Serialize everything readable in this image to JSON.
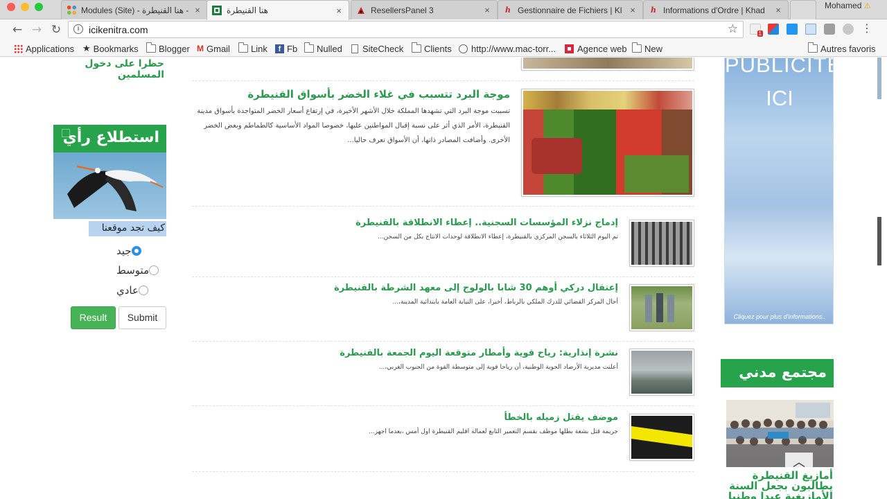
{
  "browser": {
    "tabs": [
      {
        "title": "Modules (Site) - هنا القنيطرة - ...",
        "icon": "joomla-icon",
        "active": false
      },
      {
        "title": "هنا القنيطرة",
        "icon": "site-favicon-icon",
        "active": true
      },
      {
        "title": "ResellersPanel 3",
        "icon": "resellerspanel-icon",
        "active": false
      },
      {
        "title": "Gestionnaire de Fichiers | Kl",
        "icon": "hosting-h-icon",
        "active": false
      },
      {
        "title": "Informations d'Ordre | Khad",
        "icon": "hosting-h-icon",
        "active": false
      }
    ],
    "profile_name": "Mohamed",
    "url": "icikenitra.com",
    "bookmarks": [
      {
        "label": "Applications",
        "icon": "apps-grid-icon"
      },
      {
        "label": "Bookmarks",
        "icon": "star-icon"
      },
      {
        "label": "Blogger",
        "icon": "folder-icon"
      },
      {
        "label": "Gmail",
        "icon": "gmail-icon"
      },
      {
        "label": "Link",
        "icon": "folder-icon"
      },
      {
        "label": "Fb",
        "icon": "facebook-icon"
      },
      {
        "label": "Nulled",
        "icon": "folder-icon"
      },
      {
        "label": "SiteCheck",
        "icon": "page-icon"
      },
      {
        "label": "Clients",
        "icon": "folder-icon"
      },
      {
        "label": "http://www.mac-torr...",
        "icon": "globe-icon"
      },
      {
        "label": "Agence web",
        "icon": "agence-icon"
      },
      {
        "label": "New",
        "icon": "folder-icon"
      }
    ],
    "other_bookmarks": "Autres favoris"
  },
  "left": {
    "cut_text_line1": "حظرا على دخول",
    "cut_text_line2": "المسلمين",
    "poll": {
      "heading": "استطلاع رأي",
      "question": "كيف تجد موقعنا",
      "options": [
        {
          "label": "جيد",
          "selected": true
        },
        {
          "label": "متوسط",
          "selected": false
        },
        {
          "label": "عادي",
          "selected": false
        }
      ],
      "result_label": "Result",
      "submit_label": "Submit"
    }
  },
  "articles": {
    "featured": {
      "title": "موجة البرد تتسبب في غلاء الخضر بأسواق القنيطرة",
      "excerpt": "تسببت موجة البرد التي تشهدها المملكة خلال الأشهر الأخيرة، في إرتفاع أسعار الخضر المتواجدة بأسواق مدينة القنيطرة، الأمر الذي أثر على نسبة إقبال المواطنين عليها، خصوصا المواد الأساسية كالطماطم وبعض الخضر الأخرى. وأضافت المصادر ذاتها، أن الأسواق تعرف حاليا..."
    },
    "list": [
      {
        "title": "إدماج نزلاء المؤسسات السجنية.. إعطاء الانطلاقة بالقنيطرة",
        "excerpt": "تم اليوم الثلاثاء بالسجن المركزي بالقنيطرة، إعطاء الانطلاقة لوحدات الانتاج بكل من السجن..."
      },
      {
        "title": "إعتقال دركي أوهم 30 شابا بالولوج إلى معهد الشرطة بالقنيطرة",
        "excerpt": "أحال المركز القضائي للدرك الملكي بالرباط، أخيرا، على النيابة العامة بابتدائية المدينة،..."
      },
      {
        "title": "نشرة إنذارية: رياح قوية وأمطار متوقعة اليوم الجمعة بالقنيطرة",
        "excerpt": "أعلنت مديرية الأرصاد الجوية الوطنية، أن رياحا قوية إلى متوسطة القوة من الجنوب الغربي،..."
      },
      {
        "title": "موضف يقتل زميله بالخطأ",
        "excerpt": "جريمة قتل بشعة بطلها موظف بقسم التعمير التابع لعمالة اقليم القنيطرة اول أمس ،بعدما اجهز..."
      }
    ]
  },
  "right": {
    "ad_line1": "PUBLICITE",
    "ad_line2": "ICI",
    "ad_cta": "Cliquez pour plus d'informations..",
    "section_heading": "مجتمع مدني",
    "story_title_l1": "أمازيغ القنيطرة",
    "story_title_l2": "يطالبون بجعل السنة",
    "story_title_l3": "الأمازيغية عيدا وطنيا"
  },
  "colors": {
    "brand_green": "#27a34b",
    "title_green": "#2a9a4e",
    "radio_blue": "#2f8fe4"
  }
}
